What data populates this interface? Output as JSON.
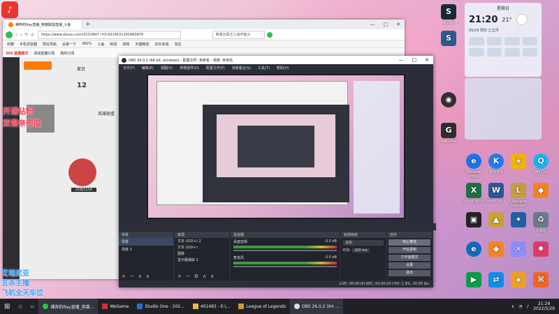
{
  "browser": {
    "tab_title": "裸奔的Ray直播_英雄联盟直播_斗鱼",
    "url": "https://www.douyu.com/3232847 r=0.9319531281660976",
    "search_text": "吴谨言看王心凌炸鱼头",
    "site_nav": "首页",
    "bookmarks": [
      "收藏",
      "手机浏览器",
      "网址导航",
      "谷歌一下",
      "360%",
      "斗鱼",
      "新闻",
      "购物",
      "天猫精选",
      "京东商城",
      "淘宝"
    ],
    "side_label": "360 直播模式",
    "side_label2": "添加直播订阅",
    "side_label3": "我的订阅",
    "sidebar_count": "12",
    "streamer_label": "英雄联盟",
    "score": "219/1114"
  },
  "overlay": {
    "line1": "开通钻粉",
    "line2": "双倍亲密度",
    "line3": "艾瑞尼亚",
    "line4": "五杀主播",
    "line5": "飞机全天车位"
  },
  "obs": {
    "title": "OBS 26.0.2 (64 bit, windows) - 配置文件: 未命名 - 场景: 未命名",
    "menu": [
      "文件(F)",
      "编辑(E)",
      "视图(V)",
      "停靠部件(D)",
      "配置文件(P)",
      "场景集合(S)",
      "工具(T)",
      "帮助(H)"
    ],
    "panel_scenes": "场景",
    "panel_sources": "来源",
    "panel_mixer": "混音器",
    "panel_transitions": "转场特效",
    "panel_controls": "控件",
    "scenes": [
      "场景",
      "场景 2"
    ],
    "sources": [
      "文本 (GDI+) 2",
      "文本 (GDI+)",
      "图像",
      "显示器捕获 2"
    ],
    "mixer": [
      {
        "name": "桌面音频",
        "db": "0.0 dB"
      },
      {
        "name": "麦克风",
        "db": "0.0 dB"
      }
    ],
    "transition": "淡出",
    "duration_label": "时长",
    "duration": "300 ms",
    "controls": [
      "停止推流",
      "开始录制",
      "工作室模式",
      "设置",
      "退出"
    ],
    "status": "LIVE: 00:00:00   REC: 00:00:00   CPU: 1.9%, 30.00 fps"
  },
  "widget": {
    "time": "21:20",
    "date": "05/29  周日 乙五月",
    "weather": "21°",
    "title": "星期日"
  },
  "desktop_icons": [
    {
      "label": "Steam",
      "color": "#1b2838"
    },
    {
      "label": "WeGame",
      "color": "#2d2d2d"
    },
    {
      "label": "Wallpaper",
      "color": "#3c3c3c"
    },
    {
      "label": "Microsoft Edge",
      "color": "#1a73e8"
    },
    {
      "label": "酷狗音乐",
      "color": "#1e7ff0"
    },
    {
      "label": "腾讯QQ",
      "color": "#12b7f5"
    },
    {
      "label": "Excel 2016",
      "color": "#1d6f42"
    },
    {
      "label": "Word 2016",
      "color": "#2b579a"
    },
    {
      "label": "League of Legends",
      "color": "#c89b3c"
    },
    {
      "label": "TeamViewer",
      "color": "#0e8ee9"
    },
    {
      "label": "回收站",
      "color": "#6a7a8a"
    }
  ],
  "taskbar": {
    "items": [
      "裸奔的Ray直播_英雄...",
      "WeGame",
      "Studio One - 202...",
      "401483 - E:\\...",
      "League of Legends",
      "OBS 26.0.2 (64 ..."
    ],
    "clock_time": "21:29",
    "clock_date": "2022/5/29"
  }
}
